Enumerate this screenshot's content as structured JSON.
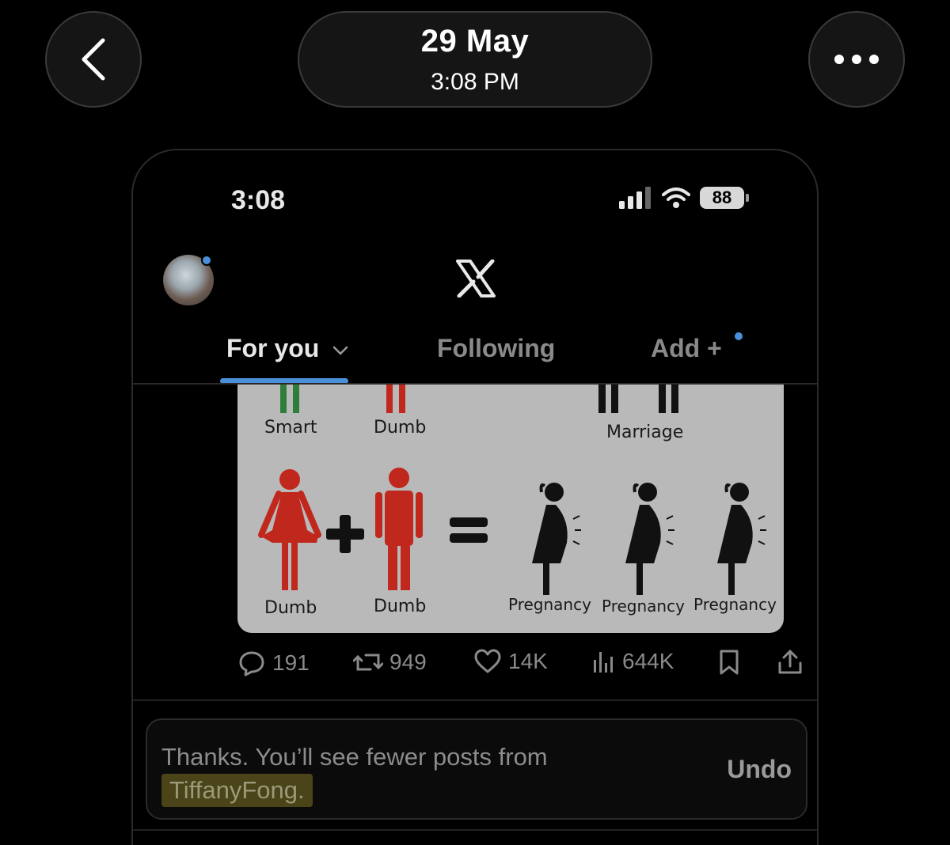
{
  "viewer": {
    "date": "29 May",
    "time": "3:08 PM"
  },
  "status_bar": {
    "time": "3:08",
    "battery": "88"
  },
  "tabs": [
    {
      "label": "For you",
      "active": true
    },
    {
      "label": "Following",
      "active": false
    },
    {
      "label": "Add +",
      "active": false
    }
  ],
  "post_image": {
    "labels": {
      "smart": "Smart",
      "dumb_top": "Dumb",
      "marriage": "Marriage",
      "dumb_left": "Dumb",
      "dumb_right": "Dumb",
      "pregnancy_1": "Pregnancy",
      "pregnancy_2": "Pregnancy",
      "pregnancy_3": "Pregnancy"
    },
    "colors": {
      "green": "#2e7d3a",
      "red": "#c0271d",
      "black": "#111111"
    }
  },
  "actions": {
    "replies": "191",
    "reposts": "949",
    "likes": "14K",
    "views": "644K"
  },
  "toast": {
    "message": "Thanks. You’ll see fewer posts from",
    "username": "TiffanyFong.",
    "undo": "Undo"
  },
  "colors": {
    "accent": "#4a90d9",
    "background": "#000000"
  }
}
